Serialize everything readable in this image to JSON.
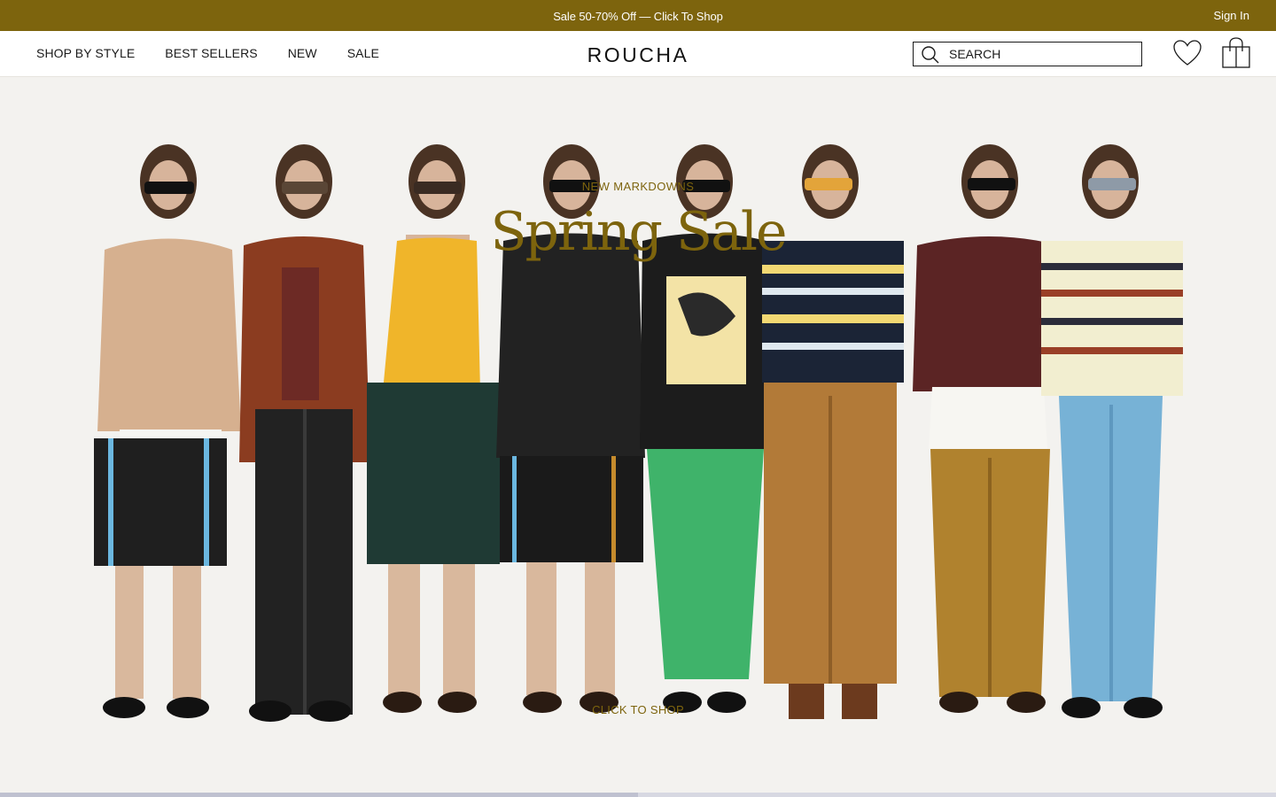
{
  "promo": {
    "text": "Sale 50-70% Off — Click To Shop",
    "sign_in": "Sign In"
  },
  "header": {
    "nav": [
      {
        "label": "SHOP BY STYLE"
      },
      {
        "label": "BEST SELLERS"
      },
      {
        "label": "NEW"
      },
      {
        "label": "SALE"
      }
    ],
    "logo": "ROUCHA",
    "search_placeholder": "SEARCH",
    "icons": [
      "search-icon",
      "heart-icon",
      "shopping-bag-icon"
    ]
  },
  "hero": {
    "eyebrow": "NEW MARKDOWNS",
    "title": "Spring Sale",
    "cta": "CLICK TO SHOP",
    "image": "eight-models-lineup-photo",
    "slider_progress": 0.5
  },
  "colors": {
    "accent": "#7d640d",
    "background": "#f3f2ef",
    "header_bg": "#ffffff",
    "slider_track": "#d7d8e2"
  }
}
